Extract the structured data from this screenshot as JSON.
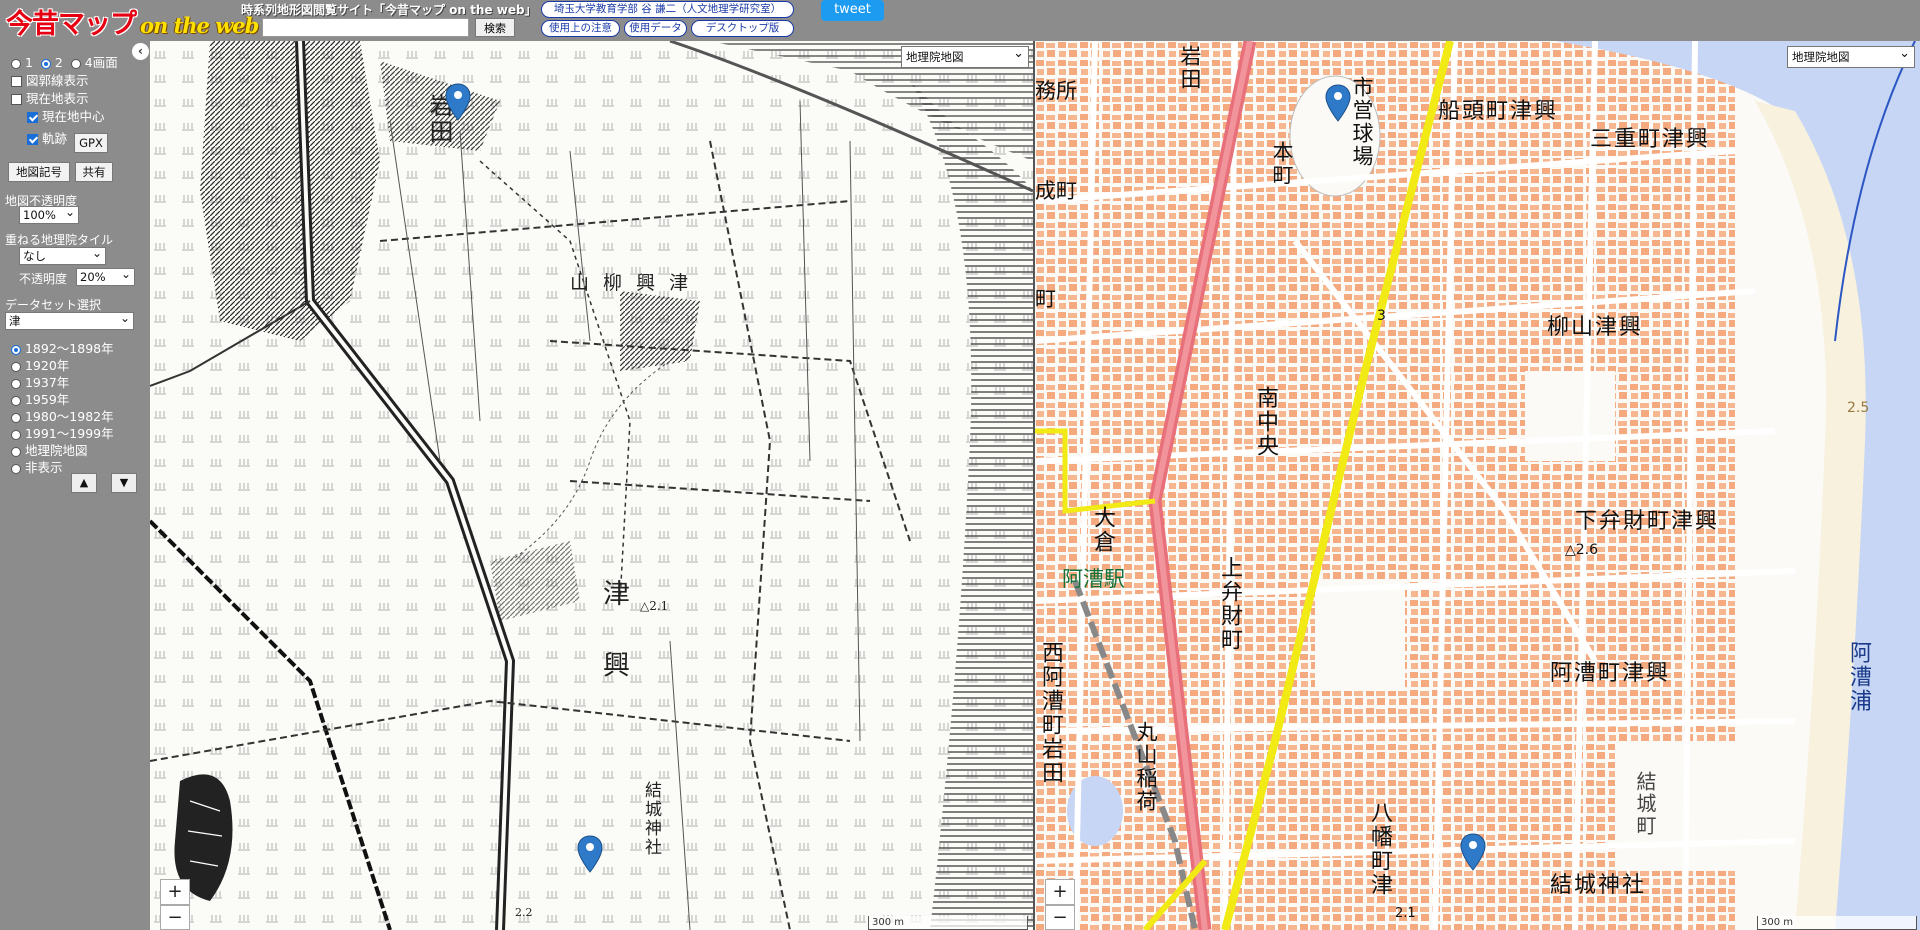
{
  "header": {
    "logo_main": "今昔マップ",
    "logo_sub": "on the web",
    "site_title": "時系列地形図閲覧サイト「今昔マップ on the web」",
    "search_placeholder": "",
    "search_button": "検索",
    "author_link": "埼玉大学教育学部 谷 謙二（人文地理学研究室）",
    "notes_link": "使用上の注意",
    "data_link": "使用データ",
    "desktop_link": "デスクトップ版",
    "tweet": "tweet"
  },
  "sidebar": {
    "collapse": "‹",
    "screens": [
      {
        "label": "1",
        "selected": false
      },
      {
        "label": "2",
        "selected": true
      },
      {
        "label": "4画面",
        "selected": false
      }
    ],
    "grid_lines": {
      "label": "図郭線表示",
      "checked": false
    },
    "current_location": {
      "label": "現在地表示",
      "checked": false
    },
    "center_current": {
      "label": "現在地中心",
      "checked": true
    },
    "track": {
      "label": "軌跡",
      "checked": true
    },
    "gpx_button": "GPX",
    "legend_button": "地図記号",
    "share_button": "共有",
    "opacity_label": "地図不透明度",
    "opacity_value": "100%",
    "overlay_label": "重ねる地理院タイル",
    "overlay_value": "なし",
    "overlay_opacity_label": "不透明度",
    "overlay_opacity_value": "20%",
    "dataset_label": "データセット選択",
    "dataset_value": "津",
    "years": [
      {
        "label": "1892～1898年",
        "selected": true
      },
      {
        "label": "1920年",
        "selected": false
      },
      {
        "label": "1937年",
        "selected": false
      },
      {
        "label": "1959年",
        "selected": false
      },
      {
        "label": "1980～1982年",
        "selected": false
      },
      {
        "label": "1991～1999年",
        "selected": false
      },
      {
        "label": "地理院地図",
        "selected": false
      },
      {
        "label": "非表示",
        "selected": false
      }
    ],
    "up_button": "▲",
    "down_button": "▼"
  },
  "map_left": {
    "layer_select": "地理院地図",
    "zoom_in": "+",
    "zoom_out": "−",
    "scale": "300 m",
    "labels": {
      "iwata": "岩田",
      "yanagiyama_tsuoki": "山 柳 興 津",
      "tsuoki": "津 興",
      "yuki_jinja": "結城神社",
      "elev1": "△2.1",
      "elev2": "2.2"
    }
  },
  "map_right": {
    "layer_select": "地理院地図",
    "zoom_in": "+",
    "zoom_out": "−",
    "scale": "300 m",
    "labels": {
      "jimusho": "務所",
      "iwata": "岩田",
      "honmachi": "本町",
      "shiei_kyujo": "市営球場",
      "sendocho": "船頭町津興",
      "miecho": "三重町津興",
      "nakamachi": "成町",
      "machi": "町",
      "minami_chuo": "南中央",
      "yanagiyama": "柳山津興",
      "shimobenzai": "下弁財町津興",
      "elev_shimo": "△2.6",
      "okura": "大倉",
      "akogi_station": "阿漕駅",
      "kamibenzai": "上弁財町",
      "nishi_akogi": "西阿漕町岩田",
      "akogicho": "阿漕町津興",
      "akogiura": "阿漕浦",
      "maruyama_inari": "丸山稲荷",
      "yuki_machi": "結城町",
      "hachiman": "八幡町津",
      "yuki_jinja": "結城神社",
      "elev_21": "2.1",
      "route_3": "3",
      "contour_25": "2.5"
    }
  }
}
